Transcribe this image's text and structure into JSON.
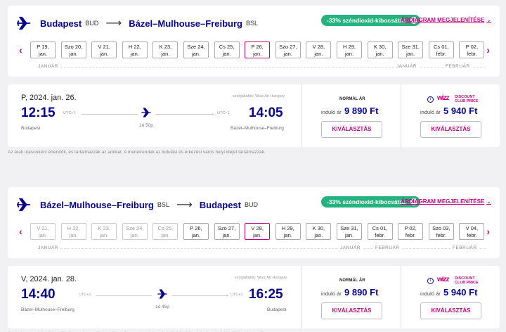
{
  "outbound": {
    "from_city": "Budapest",
    "from_code": "BUD",
    "to_city": "Bázel–Mulhouse–Freiburg",
    "to_code": "BSL",
    "co2_badge": "-33% széndioxid-kibocsátás",
    "diagram_link": "ÁRDIAGRAM MEGJELENÍTÉSE",
    "dates": [
      [
        "P 19,",
        "jan."
      ],
      [
        "Szo 20,",
        "jan."
      ],
      [
        "V 21,",
        "jan."
      ],
      [
        "H 22,",
        "jan."
      ],
      [
        "K 23,",
        "jan."
      ],
      [
        "Sze 24,",
        "jan."
      ],
      [
        "Cs 25,",
        "jan."
      ],
      [
        "P 26,",
        "jan."
      ],
      [
        "Szo 27,",
        "jan."
      ],
      [
        "V 28,",
        "jan."
      ],
      [
        "H 29,",
        "jan."
      ],
      [
        "K 30,",
        "jan."
      ],
      [
        "Sze 31,",
        "jan."
      ],
      [
        "Cs 01,",
        "febr."
      ],
      [
        "P 02,",
        "febr."
      ]
    ],
    "selected_index": 7,
    "month_labels": [
      "JANUÁR",
      "JANUÁR",
      "FEBRUÁR"
    ],
    "flight": {
      "date": "P, 2024. jan. 26.",
      "operator": "szolgáltatók: Wizz Air Hungary",
      "dep_time": "12:15",
      "arr_time": "14:05",
      "dep_utc": "UTC+1",
      "arr_utc": "UTC+1",
      "duration": "1ó 50p",
      "dep_city": "Budapest",
      "arr_city": "Bázel–Mulhouse–Freiburg",
      "normal_label": "NORMÁL ÁR",
      "from_label": "induló ár",
      "normal_price": "9 890 Ft",
      "club_price": "5 940 Ft",
      "select_label": "KIVÁLASZTÁS"
    }
  },
  "return": {
    "from_city": "Bázel–Mulhouse–Freiburg",
    "from_code": "BSL",
    "to_city": "Budapest",
    "to_code": "BUD",
    "co2_badge": "-33% széndioxid-kibocsátás",
    "diagram_link": "ÁRDIAGRAM MEGJELENÍTÉSE",
    "dates": [
      [
        "V 21,",
        "jan."
      ],
      [
        "H 22,",
        "jan."
      ],
      [
        "K 23,",
        "jan."
      ],
      [
        "Sze 24,",
        "jan."
      ],
      [
        "Cs 25,",
        "jan."
      ],
      [
        "P 26,",
        "jan."
      ],
      [
        "Szo 27,",
        "jan."
      ],
      [
        "V 28,",
        "jan."
      ],
      [
        "H 29,",
        "jan."
      ],
      [
        "K 30,",
        "jan."
      ],
      [
        "Sze 31,",
        "jan."
      ],
      [
        "Cs 01,",
        "febr."
      ],
      [
        "P 02,",
        "febr."
      ],
      [
        "Szo 03,",
        "febr."
      ],
      [
        "V 04,",
        "febr."
      ]
    ],
    "selected_index": 7,
    "month_labels": [
      "JANUÁR",
      "JANUÁR",
      "FEBRUÁR",
      "FEBRUÁR"
    ],
    "flight": {
      "date": "V, 2024. jan. 28.",
      "operator": "szolgáltatók: Wizz Air Hungary",
      "dep_time": "14:40",
      "arr_time": "16:25",
      "dep_utc": "UTC+1",
      "arr_utc": "UTC+1",
      "duration": "1ó 45p",
      "dep_city": "Bázel–Mulhouse–Freiburg",
      "arr_city": "Budapest",
      "normal_label": "NORMÁL ÁR",
      "from_label": "induló ár",
      "normal_price": "9 890 Ft",
      "club_price": "5 940 Ft",
      "select_label": "KIVÁLASZTÁS"
    }
  },
  "club_logo_top": "DISCOUNT",
  "club_logo_bottom": "CLUB PRICE",
  "footnote": "Az árak utasonként értendők, és tartalmazzák az adókat. A menetrendek az indulási és érkezési város helyi idejét tartalmazzák.",
  "colors": {
    "brand": "#06038d",
    "accent": "#c6007e",
    "co2": "#24b27f"
  },
  "icons": [
    "plane-logo-icon",
    "arrow-right-icon",
    "info-icon",
    "chevron-down-icon",
    "chevron-left-icon",
    "chevron-right-icon",
    "plane-icon"
  ]
}
